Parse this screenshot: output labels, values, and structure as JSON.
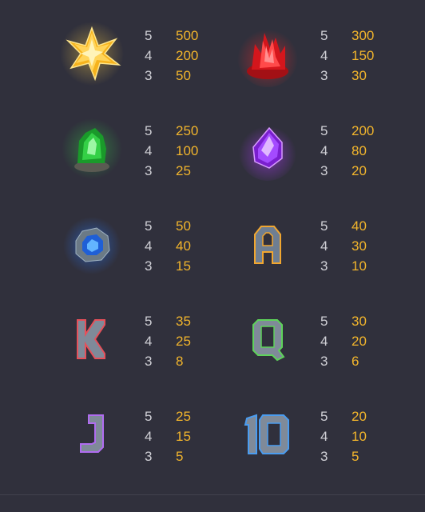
{
  "paytable": [
    {
      "symbol": "yellow-crystal-icon",
      "rows": [
        {
          "count": "5",
          "payout": "500"
        },
        {
          "count": "4",
          "payout": "200"
        },
        {
          "count": "3",
          "payout": "50"
        }
      ]
    },
    {
      "symbol": "red-crystal-icon",
      "rows": [
        {
          "count": "5",
          "payout": "300"
        },
        {
          "count": "4",
          "payout": "150"
        },
        {
          "count": "3",
          "payout": "30"
        }
      ]
    },
    {
      "symbol": "green-crystal-icon",
      "rows": [
        {
          "count": "5",
          "payout": "250"
        },
        {
          "count": "4",
          "payout": "100"
        },
        {
          "count": "3",
          "payout": "25"
        }
      ]
    },
    {
      "symbol": "purple-gem-icon",
      "rows": [
        {
          "count": "5",
          "payout": "200"
        },
        {
          "count": "4",
          "payout": "80"
        },
        {
          "count": "3",
          "payout": "20"
        }
      ]
    },
    {
      "symbol": "blue-geode-icon",
      "rows": [
        {
          "count": "5",
          "payout": "50"
        },
        {
          "count": "4",
          "payout": "40"
        },
        {
          "count": "3",
          "payout": "15"
        }
      ]
    },
    {
      "symbol": "letter-a-icon",
      "rows": [
        {
          "count": "5",
          "payout": "40"
        },
        {
          "count": "4",
          "payout": "30"
        },
        {
          "count": "3",
          "payout": "10"
        }
      ]
    },
    {
      "symbol": "letter-k-icon",
      "rows": [
        {
          "count": "5",
          "payout": "35"
        },
        {
          "count": "4",
          "payout": "25"
        },
        {
          "count": "3",
          "payout": "8"
        }
      ]
    },
    {
      "symbol": "letter-q-icon",
      "rows": [
        {
          "count": "5",
          "payout": "30"
        },
        {
          "count": "4",
          "payout": "20"
        },
        {
          "count": "3",
          "payout": "6"
        }
      ]
    },
    {
      "symbol": "letter-j-icon",
      "rows": [
        {
          "count": "5",
          "payout": "25"
        },
        {
          "count": "4",
          "payout": "15"
        },
        {
          "count": "3",
          "payout": "5"
        }
      ]
    },
    {
      "symbol": "number-10-icon",
      "rows": [
        {
          "count": "5",
          "payout": "20"
        },
        {
          "count": "4",
          "payout": "10"
        },
        {
          "count": "3",
          "payout": "5"
        }
      ]
    }
  ],
  "colors": {
    "background": "#30303c",
    "count_text": "#d0d0d6",
    "payout_text": "#f2b52c"
  }
}
